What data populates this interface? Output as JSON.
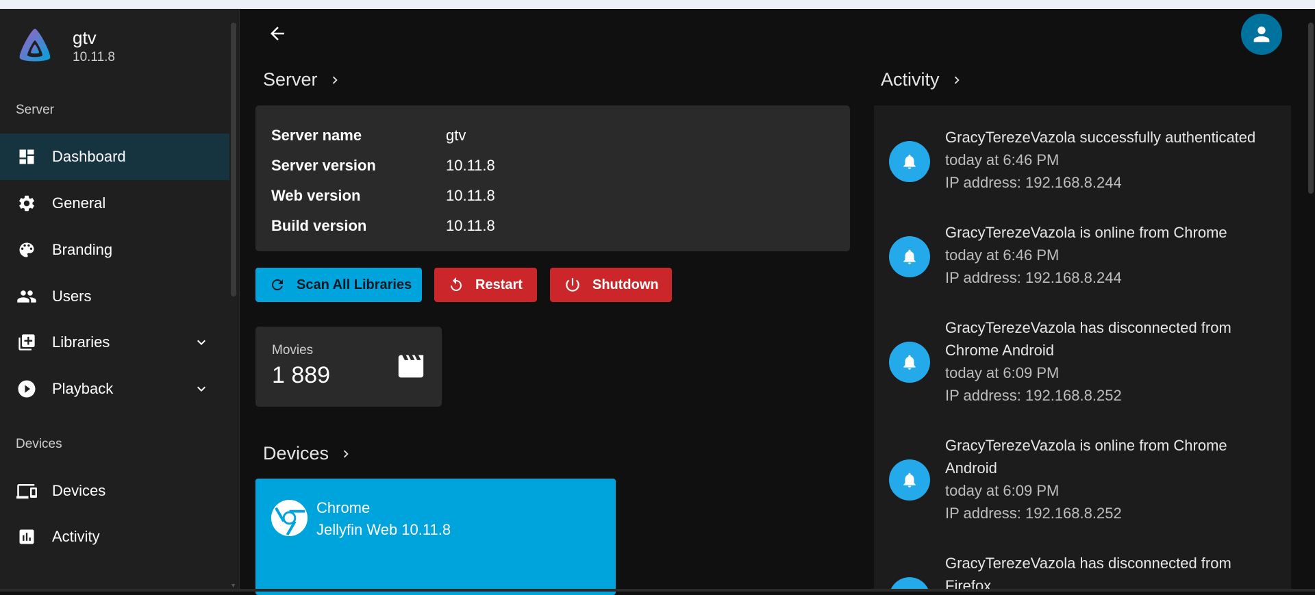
{
  "app": {
    "name": "gtv",
    "version": "10.11.8"
  },
  "sidebar": {
    "server_section": "Server",
    "devices_section": "Devices",
    "items": [
      {
        "label": "Dashboard",
        "icon": "dashboard-icon"
      },
      {
        "label": "General",
        "icon": "gear-icon"
      },
      {
        "label": "Branding",
        "icon": "palette-icon"
      },
      {
        "label": "Users",
        "icon": "users-icon"
      },
      {
        "label": "Libraries",
        "icon": "library-add-icon"
      },
      {
        "label": "Playback",
        "icon": "play-circle-icon"
      },
      {
        "label": "Devices",
        "icon": "devices-icon"
      },
      {
        "label": "Activity",
        "icon": "activity-chart-icon"
      }
    ]
  },
  "main": {
    "server_heading": "Server",
    "activity_heading": "Activity",
    "devices_heading": "Devices",
    "server_info": [
      {
        "key": "Server name",
        "value": "gtv"
      },
      {
        "key": "Server version",
        "value": "10.11.8"
      },
      {
        "key": "Web version",
        "value": "10.11.8"
      },
      {
        "key": "Build version",
        "value": "10.11.8"
      }
    ],
    "buttons": {
      "scan": "Scan All Libraries",
      "restart": "Restart",
      "shutdown": "Shutdown"
    },
    "stats": {
      "label": "Movies",
      "value": "1 889"
    },
    "device": {
      "name": "Chrome",
      "app": "Jellyfin Web 10.11.8"
    }
  },
  "activity": [
    {
      "title": "GracyTerezeVazola successfully authenticated",
      "time": "today at 6:46 PM",
      "ip": "IP address: 192.168.8.244"
    },
    {
      "title": "GracyTerezeVazola is online from Chrome",
      "time": "today at 6:46 PM",
      "ip": "IP address: 192.168.8.244"
    },
    {
      "title_line1": "GracyTerezeVazola has disconnected from",
      "title_line2": "Chrome Android",
      "time": "today at 6:09 PM",
      "ip": "IP address: 192.168.8.252"
    },
    {
      "title_line1": "GracyTerezeVazola is online from Chrome",
      "title_line2": "Android",
      "time": "today at 6:09 PM",
      "ip": "IP address: 192.168.8.252"
    },
    {
      "title_line1": "GracyTerezeVazola has disconnected from",
      "title_line2": "Firefox"
    }
  ],
  "colors": {
    "accent": "#00a4dc",
    "danger": "#cb272a",
    "active_nav": "#163340",
    "avatar": "#00729e",
    "activity_bell": "#24aaeb"
  }
}
